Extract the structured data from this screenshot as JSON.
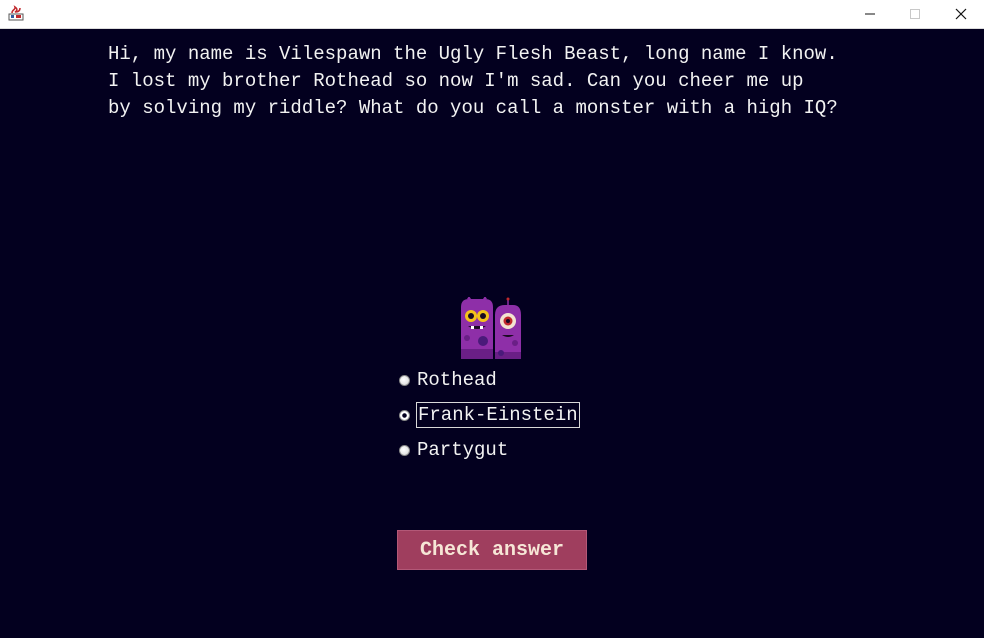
{
  "window": {
    "app_icon": "java-app-icon",
    "controls": [
      "minimize-icon",
      "maximize-icon",
      "close-icon"
    ]
  },
  "riddle": {
    "text": "Hi, my name is Vilespawn the Ugly Flesh Beast, long name I know.\nI lost my brother Rothead so now I'm sad. Can you cheer me up\nby solving my riddle? What do you call a monster with a high IQ?"
  },
  "monster": {
    "icon": "purple-monsters-icon"
  },
  "options": [
    {
      "label": "Rothead",
      "selected": false
    },
    {
      "label": "Frank-Einstein",
      "selected": false
    },
    {
      "label": "Partygut",
      "selected": false
    }
  ],
  "check_button": {
    "label": "Check answer"
  },
  "colors": {
    "background": "#03001f",
    "text": "#f2f2f2",
    "button": "#9f3e5e",
    "button_text": "#f6e6d6",
    "monster": "#8e2fa8"
  }
}
